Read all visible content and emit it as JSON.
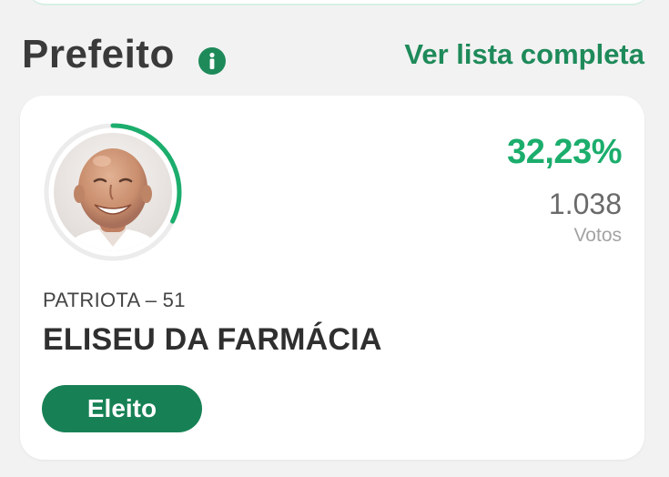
{
  "section": {
    "title": "Prefeito",
    "info_icon": "info-icon",
    "see_all_label": "Ver lista completa"
  },
  "candidate": {
    "percent_text": "32,23%",
    "percent_value": 0.3223,
    "votes": "1.038",
    "votes_label": "Votos",
    "party": "PATRIOTA – 51",
    "name": "ELISEU DA FARMÁCIA",
    "status": "Eleito",
    "photo": "candidate-portrait"
  },
  "colors": {
    "accent_green": "#1e8a5a",
    "percent_green": "#1bad6c",
    "badge_green": "#178155",
    "ring_track": "#ececec"
  }
}
